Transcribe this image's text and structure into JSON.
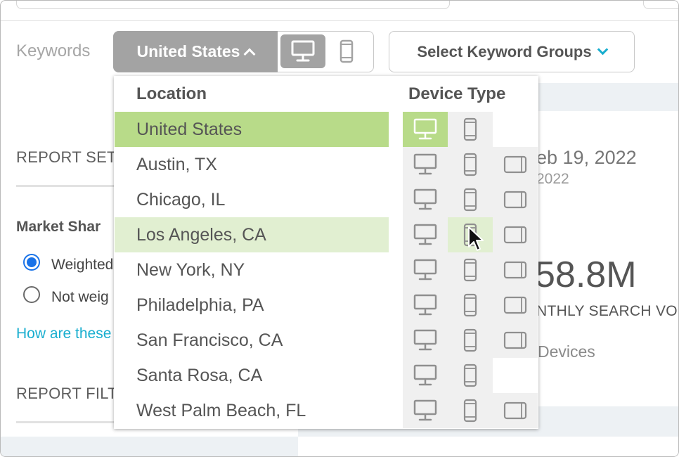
{
  "toolbar": {
    "keywords_label": "Keywords",
    "location_button_label": "United States",
    "keyword_groups_label": "Select Keyword Groups",
    "selected_device": "desktop"
  },
  "sidebar": {
    "report_settings": "REPORT SET",
    "market_share": "Market Shar",
    "weighted_label": "Weighted",
    "not_weighted_label": "Not weig",
    "how_link": "How are these",
    "report_filters": "REPORT FILT"
  },
  "summary": {
    "date_range_line1": "eb 19, 2022",
    "date_range_line2": "2022",
    "big_number": "58.8M",
    "monthly_label": "NTHLY SEARCH VOL",
    "devices_label": "Devices"
  },
  "dropdown": {
    "location_header": "Location",
    "device_header": "Device Type",
    "rows": [
      {
        "label": "United States",
        "state": "selected",
        "devices": [
          "desktop",
          "mobile"
        ],
        "active_device": "desktop"
      },
      {
        "label": "Austin, TX",
        "state": "normal",
        "devices": [
          "desktop",
          "mobile",
          "tablet"
        ]
      },
      {
        "label": "Chicago, IL",
        "state": "normal",
        "devices": [
          "desktop",
          "mobile",
          "tablet"
        ]
      },
      {
        "label": "Los Angeles, CA",
        "state": "hover",
        "devices": [
          "desktop",
          "mobile",
          "tablet"
        ],
        "hover_device": "mobile"
      },
      {
        "label": "New York, NY",
        "state": "normal",
        "devices": [
          "desktop",
          "mobile",
          "tablet"
        ]
      },
      {
        "label": "Philadelphia, PA",
        "state": "normal",
        "devices": [
          "desktop",
          "mobile",
          "tablet"
        ]
      },
      {
        "label": "San Francisco, CA",
        "state": "normal",
        "devices": [
          "desktop",
          "mobile",
          "tablet"
        ]
      },
      {
        "label": "Santa Rosa, CA",
        "state": "normal",
        "devices": [
          "desktop",
          "mobile"
        ]
      },
      {
        "label": "West Palm Beach, FL",
        "state": "normal",
        "devices": [
          "desktop",
          "mobile",
          "tablet"
        ]
      }
    ]
  },
  "colors": {
    "selected_green": "#b8db89",
    "hover_green": "#e1efd1",
    "accent_teal": "#19aecf",
    "radio_blue": "#1a73e8",
    "button_gray": "#a3a3a3"
  }
}
